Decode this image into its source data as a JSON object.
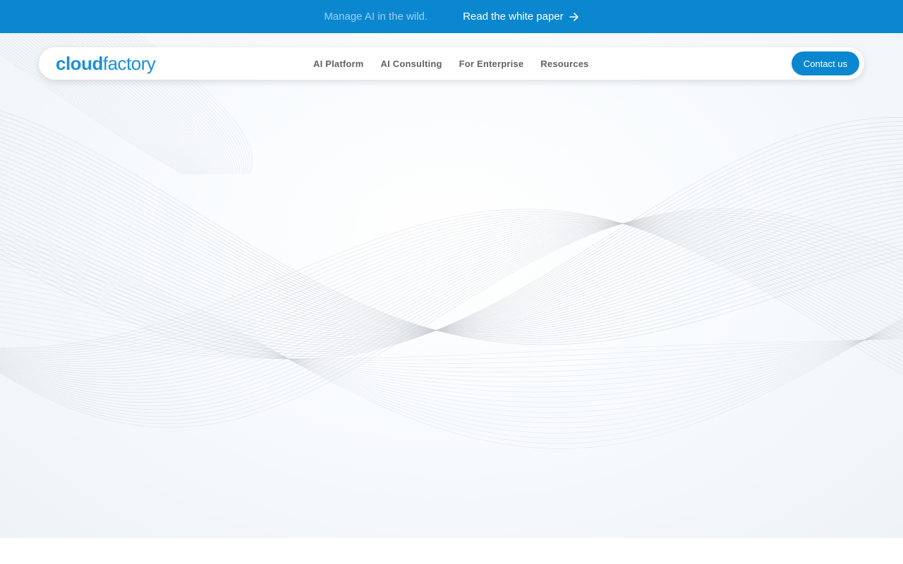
{
  "announcement": {
    "text": "Manage AI in the wild.",
    "link_label": "Read the white paper",
    "link_icon": "arrow-right-icon"
  },
  "nav": {
    "logo_bold": "cloud",
    "logo_light": "factory",
    "links": [
      "AI Platform",
      "AI Consulting",
      "For Enterprise",
      "Resources"
    ],
    "cta_label": "Contact us"
  },
  "colors": {
    "brand_blue": "#0b87d0",
    "logo_blue": "#1a90d9",
    "nav_text": "#5e6369",
    "wave_gray": "#c8ced4"
  }
}
